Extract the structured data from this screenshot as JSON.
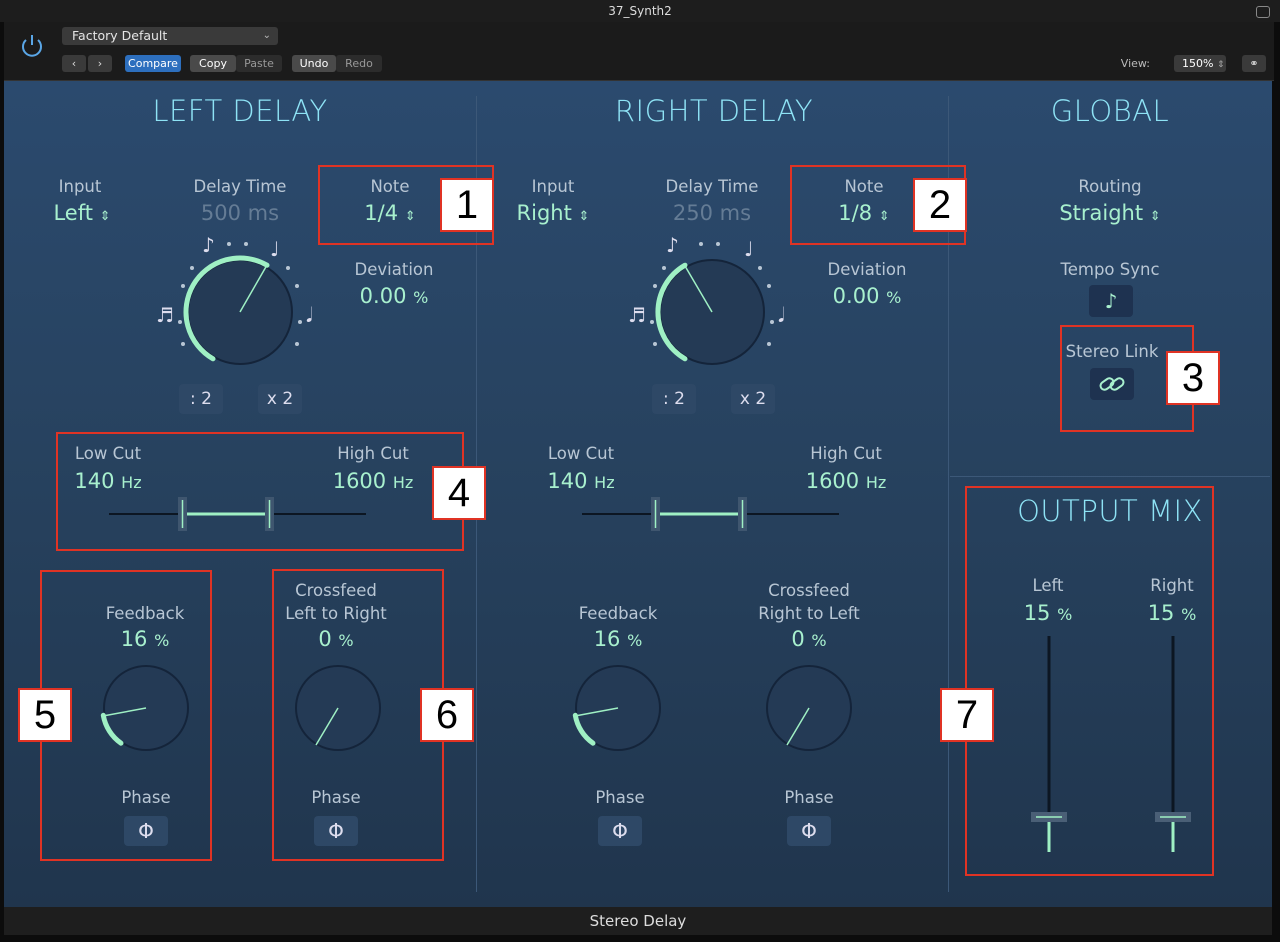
{
  "window": {
    "title": "37_Synth2"
  },
  "header": {
    "preset": "Factory Default",
    "compare": "Compare",
    "copy": "Copy",
    "paste": "Paste",
    "undo": "Undo",
    "redo": "Redo",
    "view_label": "View:",
    "view_value": "150%"
  },
  "left": {
    "title": "LEFT DELAY",
    "input_label": "Input",
    "input_value": "Left",
    "delay_label": "Delay Time",
    "delay_value": "500 ms",
    "note_label": "Note",
    "note_value": "1/4",
    "deviation_label": "Deviation",
    "deviation_value": "0.00",
    "half": ": 2",
    "double": "x 2",
    "lowcut_label": "Low Cut",
    "lowcut_value": "140",
    "highcut_label": "High Cut",
    "highcut_value": "1600",
    "feedback_label": "Feedback",
    "feedback_value": "16",
    "crossfeed_label1": "Crossfeed",
    "crossfeed_label2": "Left to Right",
    "crossfeed_value": "0",
    "phase_label": "Phase"
  },
  "right": {
    "title": "RIGHT DELAY",
    "input_label": "Input",
    "input_value": "Right",
    "delay_label": "Delay Time",
    "delay_value": "250 ms",
    "note_label": "Note",
    "note_value": "1/8",
    "deviation_label": "Deviation",
    "deviation_value": "0.00",
    "half": ": 2",
    "double": "x 2",
    "lowcut_label": "Low Cut",
    "lowcut_value": "140",
    "highcut_label": "High Cut",
    "highcut_value": "1600",
    "feedback_label": "Feedback",
    "feedback_value": "16",
    "crossfeed_label1": "Crossfeed",
    "crossfeed_label2": "Right to Left",
    "crossfeed_value": "0",
    "phase_label": "Phase"
  },
  "global": {
    "title": "GLOBAL",
    "routing_label": "Routing",
    "routing_value": "Straight",
    "tempo_label": "Tempo Sync",
    "stereo_label": "Stereo Link"
  },
  "output": {
    "title": "OUTPUT MIX",
    "left_label": "Left",
    "left_value": "15",
    "right_label": "Right",
    "right_value": "15"
  },
  "units": {
    "percent": "%",
    "hz": "Hz"
  },
  "plugin_name": "Stereo Delay",
  "callouts": [
    "1",
    "2",
    "3",
    "4",
    "5",
    "6",
    "7"
  ],
  "colors": {
    "accent": "#a8f0ce",
    "section": "#8ee3f5",
    "callout": "#e03324"
  }
}
